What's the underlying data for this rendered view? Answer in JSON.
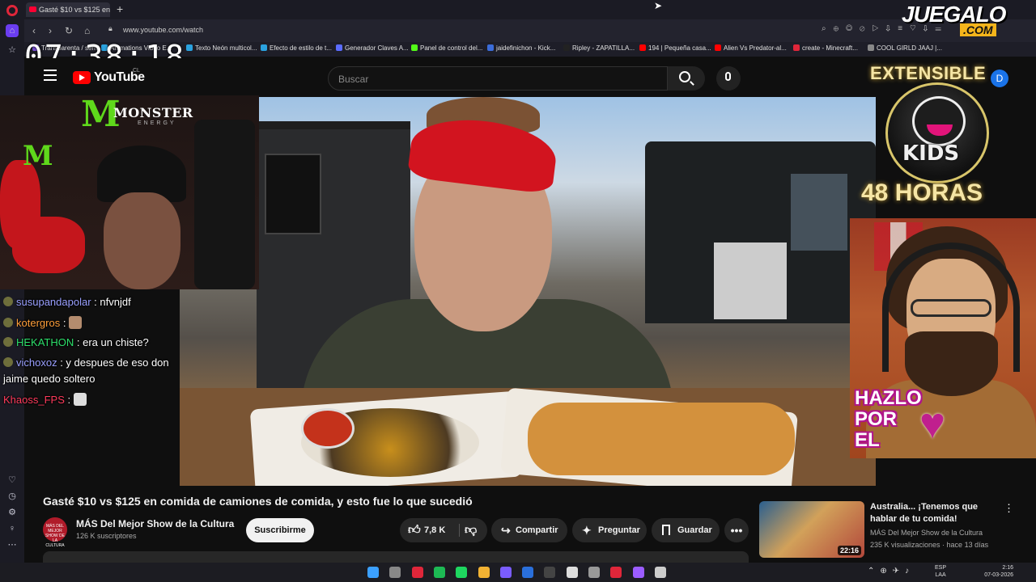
{
  "browser": {
    "tab_title": "Gasté $10 vs $125 en",
    "new_tab_symbol": "+",
    "url": "www.youtube.com/watch",
    "bookmarks": [
      {
        "label": "Transparenta / serni...",
        "color": "#7a4fd8"
      },
      {
        "label": "Animations Video E...",
        "color": "#2aa2df"
      },
      {
        "label": "Texto Neón multicol...",
        "color": "#2aa2df"
      },
      {
        "label": "Efecto de estilo de t...",
        "color": "#2aa2df"
      },
      {
        "label": "Generador Claves A...",
        "color": "#5b6cff"
      },
      {
        "label": "Panel de control del...",
        "color": "#53fc18"
      },
      {
        "label": "jaidefinichon - Kick...",
        "color": "#3b6cd9"
      },
      {
        "label": "Ripley - ZAPATILLA...",
        "color": "#222222"
      },
      {
        "label": "194 | Pequeña casa...",
        "color": "#ff0000"
      },
      {
        "label": "Alien Vs Predator-al...",
        "color": "#ff0000"
      },
      {
        "label": "create - Minecraft...",
        "color": "#e0263a"
      },
      {
        "label": "COOL GIRLD JAAJ |...",
        "color": "#888888"
      }
    ]
  },
  "overlay": {
    "clock": "07:38:18",
    "monster_brand": "MONSTER",
    "monster_sub": "ENERGY",
    "monster_mark": "M",
    "extensible": "EXTENSIBLE",
    "kids": "KIDS",
    "horas": "48 HORAS",
    "hazlo": "HAZLO\nPOR\nEL",
    "watermark_main": "JUEGALO",
    "watermark_com": ".COM"
  },
  "chat": [
    {
      "user": "susupandapolar",
      "user_color": "#9aa0ff",
      "message": ": nfvnjdf",
      "emote": null,
      "badge": true
    },
    {
      "user": "kotergros",
      "user_color": "#ff9f3a",
      "message": ":",
      "emote": "face",
      "badge": true
    },
    {
      "user": "HEKATHON",
      "user_color": "#2de06b",
      "message": ": era un chiste?",
      "emote": null,
      "badge": true
    },
    {
      "user": "vichoxoz",
      "user_color": "#9aa0ff",
      "message": ": y despues de eso don",
      "emote": null,
      "badge": true
    },
    {
      "user": "",
      "user_color": "#ffffff",
      "message": "jaime quedo soltero",
      "emote": null,
      "badge": false
    },
    {
      "user": "Khaoss_FPS",
      "user_color": "#ff3b5c",
      "message": ":",
      "emote": "cat",
      "badge": false
    }
  ],
  "youtube": {
    "wordmark": "YouTube",
    "region": "CL",
    "search_placeholder": "Buscar",
    "account_initial": "D",
    "video": {
      "title": "Gasté $10 vs $125 en comida de camiones de comida, y esto fue lo que sucedió",
      "channel_name": "MÁS Del Mejor Show de la Cultura",
      "channel_avatar_text": "MÁS DEL MEJOR SHOW DE LA CULTURA",
      "subscribers": "126 K suscriptores",
      "subscribe_label": "Suscribirme",
      "likes": "7,8 K",
      "share_label": "Compartir",
      "ask_label": "Preguntar",
      "save_label": "Guardar"
    },
    "recommended": {
      "title": "Australia... ¡Tenemos que hablar de tu comida!",
      "channel": "MÁS Del Mejor Show de la Cultura",
      "meta": "235 K visualizaciones · hace 13 días",
      "duration": "22:16"
    }
  },
  "taskbar": {
    "icon_colors": [
      "#3ba0ff",
      "#888888",
      "#e0263a",
      "#1db954",
      "#1ed760",
      "#f2b233",
      "#7a5cff",
      "#2a6fdb",
      "#444444",
      "#dddddd",
      "#999999",
      "#e0263a",
      "#9b5cff",
      "#cccccc"
    ],
    "language": "ESP",
    "language_sub": "LAA",
    "time": "2:16",
    "date": "07-03-2026"
  }
}
